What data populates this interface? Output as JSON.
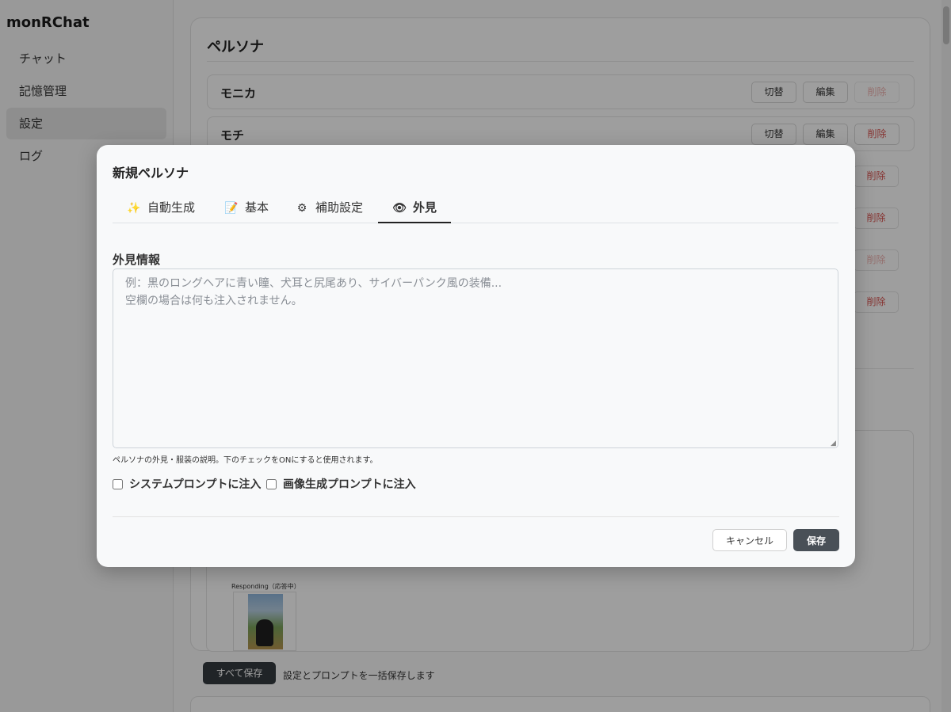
{
  "app": {
    "title": "monRChat"
  },
  "sidebar": {
    "items": [
      {
        "label": "チャット"
      },
      {
        "label": "記憶管理"
      },
      {
        "label": "設定"
      },
      {
        "label": "ログ"
      }
    ]
  },
  "main": {
    "persona_section_title": "ペルソナ",
    "personas": [
      {
        "name": "モニカ",
        "switch": "切替",
        "edit": "編集",
        "delete": "削除"
      },
      {
        "name": "モチ",
        "switch": "切替",
        "edit": "編集",
        "delete": "削除"
      }
    ],
    "background_delete_label": "削除",
    "image_caption": "Responding（応答中）",
    "save_all_button": "すべて保存",
    "save_all_desc": "設定とプロンプトを一括保存します"
  },
  "modal": {
    "title": "新規ペルソナ",
    "tabs": [
      {
        "label": "自動生成",
        "icon": "sparkles-icon",
        "glyph": "✨"
      },
      {
        "label": "基本",
        "icon": "memo-icon",
        "glyph": "📝"
      },
      {
        "label": "補助設定",
        "icon": "gear-icon",
        "glyph": "⚙"
      },
      {
        "label": "外見",
        "icon": "eye-icon",
        "glyph": "👁"
      }
    ],
    "active_tab": "外見",
    "field_label": "外見情報",
    "textarea_placeholder": "例：黒のロングヘアに青い瞳、犬耳と尻尾あり、サイバーパンク風の装備...\n空欄の場合は何も注入されません。",
    "textarea_value": "",
    "help_text": "ペルソナの外見・服装の説明。下のチェックをONにすると使用されます。",
    "checkbox_system": {
      "label": "システムプロンプトに注入",
      "checked": false
    },
    "checkbox_image": {
      "label": "画像生成プロンプトに注入",
      "checked": false
    },
    "cancel_label": "キャンセル",
    "save_label": "保存"
  },
  "colors": {
    "overlay": "#000000",
    "primary_button": "#495057",
    "delete_text": "#d9534f"
  }
}
